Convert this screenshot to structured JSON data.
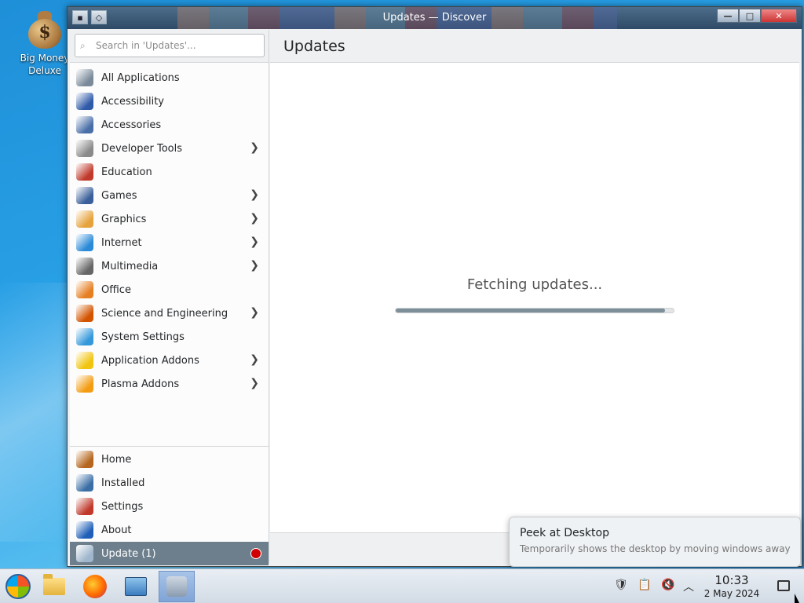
{
  "desktop": {
    "icon_label": "Big Money Deluxe"
  },
  "window": {
    "title": "Updates — Discover"
  },
  "search": {
    "placeholder": "Search in 'Updates'..."
  },
  "categories": [
    {
      "label": "All Applications",
      "icon": "all-applications-icon",
      "color": "#7a8a9a",
      "has_children": false
    },
    {
      "label": "Accessibility",
      "icon": "accessibility-icon",
      "color": "#2f5aa8",
      "has_children": false
    },
    {
      "label": "Accessories",
      "icon": "accessories-icon",
      "color": "#4a6fa8",
      "has_children": false
    },
    {
      "label": "Developer Tools",
      "icon": "developer-tools-icon",
      "color": "#8a8a8a",
      "has_children": true
    },
    {
      "label": "Education",
      "icon": "education-icon",
      "color": "#c0392b",
      "has_children": false
    },
    {
      "label": "Games",
      "icon": "games-icon",
      "color": "#3a5f9a",
      "has_children": true
    },
    {
      "label": "Graphics",
      "icon": "graphics-icon",
      "color": "#e6a23c",
      "has_children": true
    },
    {
      "label": "Internet",
      "icon": "internet-icon",
      "color": "#2a8ad8",
      "has_children": true
    },
    {
      "label": "Multimedia",
      "icon": "multimedia-icon",
      "color": "#666666",
      "has_children": true
    },
    {
      "label": "Office",
      "icon": "office-icon",
      "color": "#e67e22",
      "has_children": false
    },
    {
      "label": "Science and Engineering",
      "icon": "science-icon",
      "color": "#d35400",
      "has_children": true
    },
    {
      "label": "System Settings",
      "icon": "system-settings-icon",
      "color": "#3498db",
      "has_children": false
    },
    {
      "label": "Application Addons",
      "icon": "application-addons-icon",
      "color": "#f1c40f",
      "has_children": true
    },
    {
      "label": "Plasma Addons",
      "icon": "plasma-addons-icon",
      "color": "#f39c12",
      "has_children": true
    }
  ],
  "bottom_nav": [
    {
      "label": "Home",
      "icon": "home-icon",
      "color": "#b5651d"
    },
    {
      "label": "Installed",
      "icon": "installed-list-icon",
      "color": "#3a6ea5"
    },
    {
      "label": "Settings",
      "icon": "settings-tools-icon",
      "color": "#c0392b"
    },
    {
      "label": "About",
      "icon": "info-icon",
      "color": "#1f5fb8"
    },
    {
      "label": "Update (1)",
      "icon": "update-icon",
      "color": "#9fb6cc"
    }
  ],
  "main": {
    "header": "Updates",
    "status_text": "Fetching updates...",
    "progress": 0.97
  },
  "tooltip": {
    "title": "Peek at Desktop",
    "subtitle": "Temporarily shows the desktop by moving windows away"
  },
  "taskbar": {
    "time": "10:33",
    "date": "2 May 2024"
  }
}
